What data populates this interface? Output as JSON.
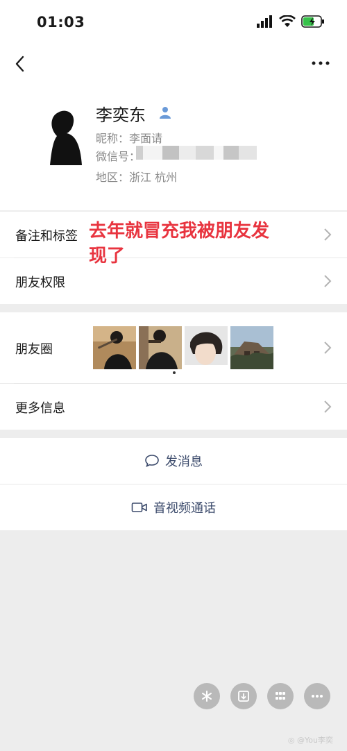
{
  "status_bar": {
    "time": "01:03"
  },
  "profile": {
    "name": "李奕东",
    "nickname": "昵称：李面请",
    "wechat_id_label": "微信号：",
    "region": "地区：浙江 杭州"
  },
  "overlay": {
    "line1": "去年就冒充我被朋友发",
    "line2": "现了"
  },
  "rows": {
    "remarks": "备注和标签",
    "permissions": "朋友权限",
    "moments": "朋友圈",
    "more_info": "更多信息"
  },
  "actions": {
    "message": "发消息",
    "call": "音视频通话"
  },
  "watermark": "@You李奕"
}
